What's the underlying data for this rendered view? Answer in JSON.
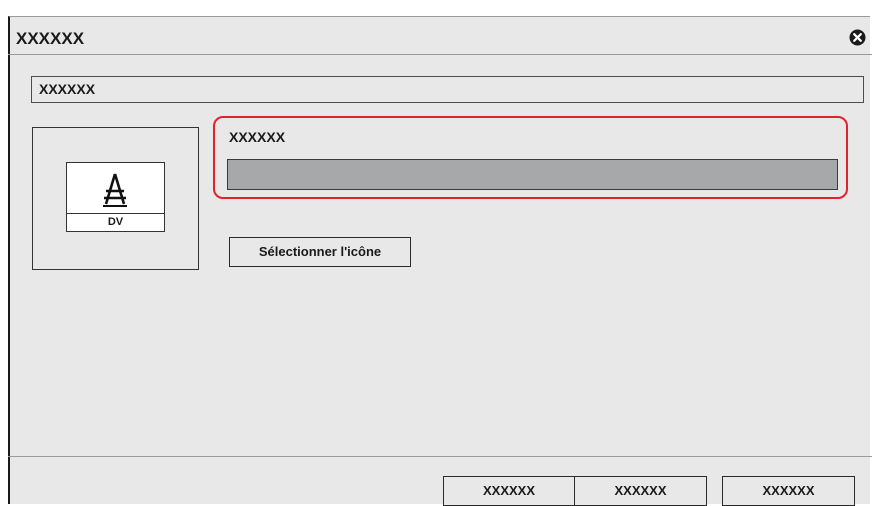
{
  "dialog": {
    "title": "XXXXXX",
    "close_icon": "close-circle-icon"
  },
  "name_field": {
    "value": "XXXXXX"
  },
  "icon_preview": {
    "icon": "antenna-icon",
    "label": "DV"
  },
  "settings": {
    "field_label": "XXXXXX",
    "field_value": "",
    "select_icon_label": "Sélectionner l'icône"
  },
  "footer": {
    "buttons": [
      "XXXXXX",
      "XXXXXX",
      "XXXXXX"
    ]
  },
  "colors": {
    "dialog_bg": "#e8e8e9",
    "highlight": "#e2222e",
    "input_fill": "#a7a8aa"
  }
}
